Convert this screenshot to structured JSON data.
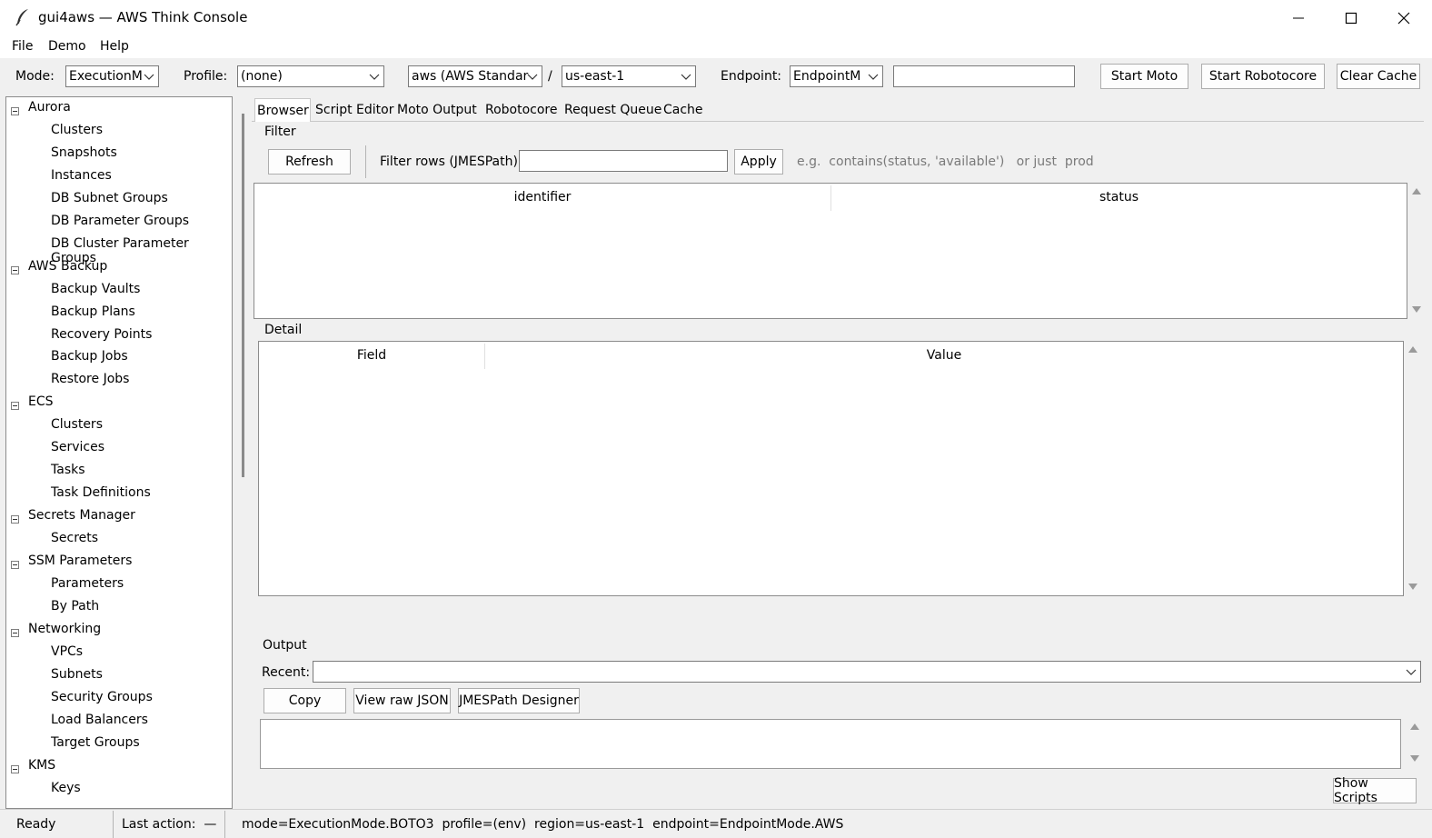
{
  "window": {
    "title": "gui4aws — AWS Think Console",
    "minimize_icon": "minimize-icon",
    "maximize_icon": "maximize-icon",
    "close_icon": "close-icon"
  },
  "menu": [
    "File",
    "Demo",
    "Help"
  ],
  "toolbar": {
    "mode_label": "Mode:",
    "mode_value": "ExecutionM",
    "profile_label": "Profile:",
    "profile_value": "(none)",
    "partition_value": "aws (AWS Standar",
    "separator": "/",
    "region_value": "us-east-1",
    "endpoint_label": "Endpoint:",
    "endpoint_value": "EndpointM",
    "endpoint_url_value": "",
    "start_moto": "Start Moto",
    "start_robotocore": "Start Robotocore",
    "clear_cache": "Clear Cache"
  },
  "tree": [
    {
      "label": "Aurora",
      "children": [
        "Clusters",
        "Snapshots",
        "Instances",
        "DB Subnet Groups",
        "DB Parameter Groups",
        "DB Cluster Parameter Groups"
      ]
    },
    {
      "label": "AWS Backup",
      "children": [
        "Backup Vaults",
        "Backup Plans",
        "Recovery Points",
        "Backup Jobs",
        "Restore Jobs"
      ]
    },
    {
      "label": "ECS",
      "children": [
        "Clusters",
        "Services",
        "Tasks",
        "Task Definitions"
      ]
    },
    {
      "label": "Secrets Manager",
      "children": [
        "Secrets"
      ]
    },
    {
      "label": "SSM Parameters",
      "children": [
        "Parameters",
        "By Path"
      ]
    },
    {
      "label": "Networking",
      "children": [
        "VPCs",
        "Subnets",
        "Security Groups",
        "Load Balancers",
        "Target Groups"
      ]
    },
    {
      "label": "KMS",
      "children": [
        "Keys"
      ]
    }
  ],
  "tabs": [
    "Browser",
    "Script Editor",
    "Moto Output",
    "Robotocore",
    "Request Queue",
    "Cache"
  ],
  "filter": {
    "section_label": "Filter",
    "refresh": "Refresh",
    "filter_label": "Filter rows (JMESPath):",
    "filter_value": "",
    "apply": "Apply",
    "hint": "e.g.  contains(status, 'available')   or just  prod"
  },
  "results_table": {
    "columns": [
      "identifier",
      "status"
    ],
    "rows": []
  },
  "detail": {
    "section_label": "Detail",
    "columns": [
      "Field",
      "Value"
    ],
    "rows": []
  },
  "output": {
    "section_label": "Output",
    "recent_label": "Recent:",
    "recent_value": "",
    "copy": "Copy",
    "view_raw_json": "View raw JSON",
    "jmespath_designer": "JMESPath Designer",
    "text": ""
  },
  "show_scripts": "Show Scripts",
  "statusbar": {
    "ready": "Ready",
    "last_action": "Last action:  —",
    "info": "mode=ExecutionMode.BOTO3  profile=(env)  region=us-east-1  endpoint=EndpointMode.AWS"
  }
}
